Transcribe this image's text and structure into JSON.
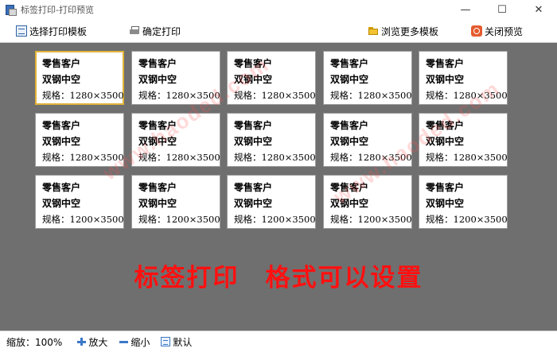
{
  "window": {
    "title": "标签打印-打印预览",
    "minimize_glyph": "—",
    "maximize_glyph": "☐",
    "close_glyph": "✕"
  },
  "toolbar": {
    "select_template": "选择打印模板",
    "confirm_print": "确定打印",
    "browse_templates": "浏览更多模板",
    "close_preview": "关闭预览"
  },
  "labels": [
    {
      "customer": "零售客户",
      "product": "双钢中空",
      "spec": "规格：1280×3500"
    },
    {
      "customer": "零售客户",
      "product": "双钢中空",
      "spec": "规格：1280×3500"
    },
    {
      "customer": "零售客户",
      "product": "双钢中空",
      "spec": "规格：1280×3500"
    },
    {
      "customer": "零售客户",
      "product": "双钢中空",
      "spec": "规格：1280×3500"
    },
    {
      "customer": "零售客户",
      "product": "双钢中空",
      "spec": "规格：1280×3500"
    },
    {
      "customer": "零售客户",
      "product": "双钢中空",
      "spec": "规格：1280×3500"
    },
    {
      "customer": "零售客户",
      "product": "双钢中空",
      "spec": "规格：1280×3500"
    },
    {
      "customer": "零售客户",
      "product": "双钢中空",
      "spec": "规格：1280×3500"
    },
    {
      "customer": "零售客户",
      "product": "双钢中空",
      "spec": "规格：1280×3500"
    },
    {
      "customer": "零售客户",
      "product": "双钢中空",
      "spec": "规格：1280×3500"
    },
    {
      "customer": "零售客户",
      "product": "双钢中空",
      "spec": "规格：1200×3500"
    },
    {
      "customer": "零售客户",
      "product": "双钢中空",
      "spec": "规格：1200×3500"
    },
    {
      "customer": "零售客户",
      "product": "双钢中空",
      "spec": "规格：1200×3500"
    },
    {
      "customer": "零售客户",
      "product": "双钢中空",
      "spec": "规格：1200×3500"
    },
    {
      "customer": "零售客户",
      "product": "双钢中空",
      "spec": "规格：1200×3500"
    }
  ],
  "watermark": "www.haoded.com",
  "banner": "标签打印　格式可以设置",
  "statusbar": {
    "zoom_label": "缩放：100%",
    "zoom_in": "放大",
    "zoom_out": "缩小",
    "default": "默认"
  },
  "colors": {
    "preview_bg": "#6f6f6f",
    "banner": "#ff1010",
    "selected_border": "#e0b33a",
    "accent_icon": "#3c78c8"
  }
}
